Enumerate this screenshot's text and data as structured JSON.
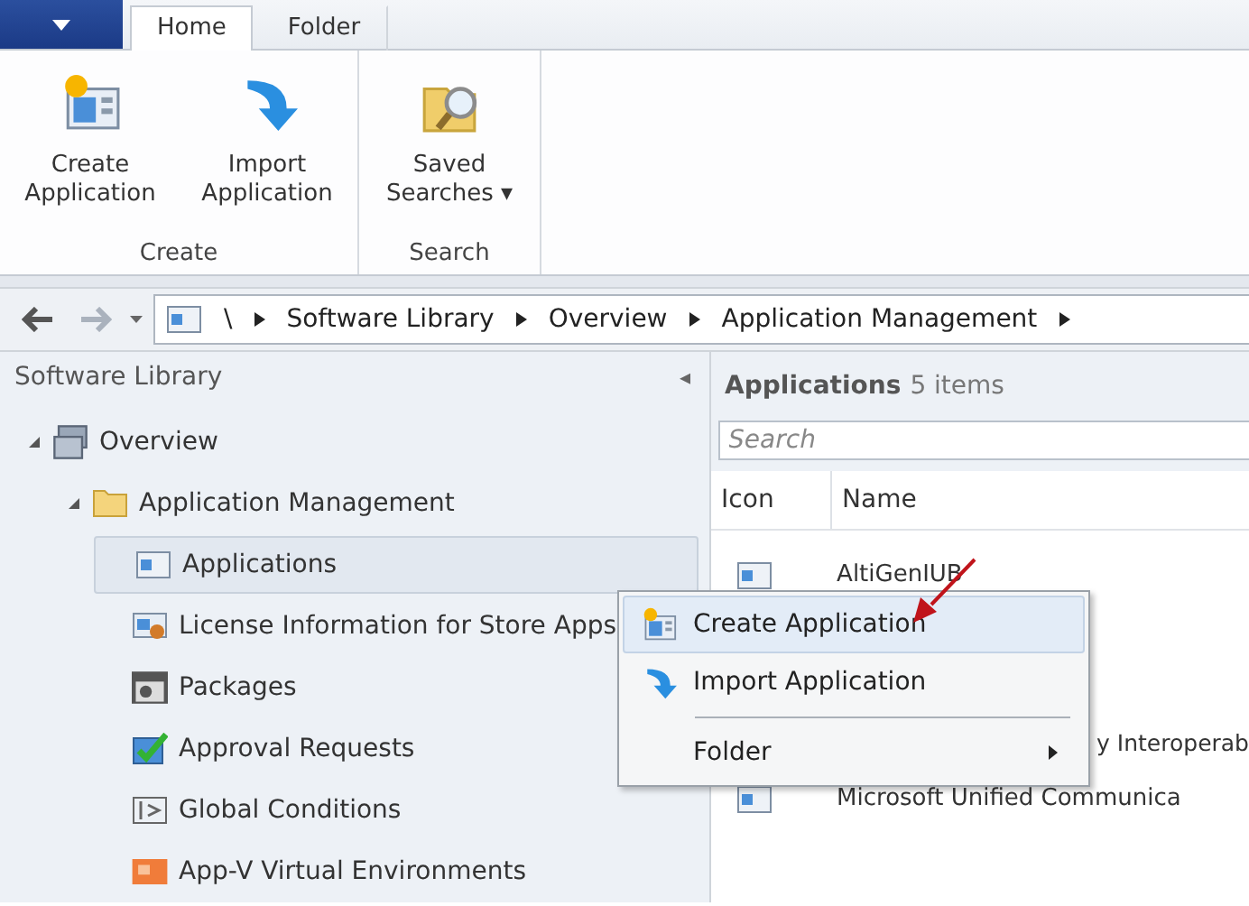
{
  "ribbon": {
    "tabs": [
      {
        "label": "Home",
        "selected": true
      },
      {
        "label": "Folder",
        "selected": false
      }
    ],
    "groups": [
      {
        "label": "Create",
        "buttons": [
          {
            "label": "Create Application"
          },
          {
            "label": "Import Application"
          }
        ]
      },
      {
        "label": "Search",
        "buttons": [
          {
            "label": "Saved Searches",
            "menu_marker": "▾"
          }
        ]
      }
    ]
  },
  "address_bar": {
    "root": "\\",
    "crumbs": [
      "Software Library",
      "Overview",
      "Application Management"
    ]
  },
  "navigation": {
    "title": "Software Library",
    "collapse": "◂",
    "tree": [
      {
        "label": "Overview",
        "expanded": true,
        "selected": false,
        "children": [
          {
            "label": "Application Management",
            "expanded": true,
            "selected": false,
            "children": [
              {
                "label": "Applications",
                "selected": true
              },
              {
                "label": "License Information for Store Apps",
                "selected": false
              },
              {
                "label": "Packages",
                "selected": false
              },
              {
                "label": "Approval Requests",
                "selected": false
              },
              {
                "label": "Global Conditions",
                "selected": false
              },
              {
                "label": "App-V Virtual Environments",
                "selected": false
              }
            ]
          }
        ]
      }
    ]
  },
  "list": {
    "title": "Applications",
    "count": "5 items",
    "search": {
      "placeholder": "Search"
    },
    "columns": [
      "Icon",
      "Name"
    ],
    "rows": [
      {
        "kind": "full",
        "name": "AltiGenIUB"
      },
      {
        "kind": "hidden"
      },
      {
        "kind": "hidden"
      },
      {
        "kind": "partial",
        "name": "y Interoperab"
      },
      {
        "kind": "full",
        "name": "Microsoft Unified Communica"
      }
    ]
  },
  "context_menu": {
    "items": [
      {
        "kind": "item",
        "label": "Create Application",
        "selected": true
      },
      {
        "kind": "item",
        "label": "Import Application",
        "selected": false
      },
      {
        "kind": "separator"
      },
      {
        "kind": "submenu",
        "label": "Folder",
        "selected": false
      }
    ]
  }
}
